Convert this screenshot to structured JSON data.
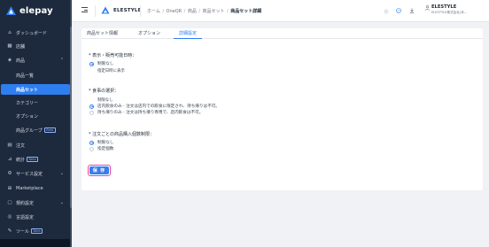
{
  "app": {
    "logo_text": "elepay"
  },
  "sidebar": {
    "items": [
      {
        "label": "ダッシュボード",
        "icon": "home-icon"
      },
      {
        "label": "店舗",
        "icon": "store-icon"
      },
      {
        "label": "商品",
        "icon": "tag-icon",
        "expanded": true
      },
      {
        "label": "商品一覧",
        "sub": true
      },
      {
        "label": "商品セット",
        "sub": true,
        "active": true
      },
      {
        "label": "カテゴリー",
        "sub": true
      },
      {
        "label": "オプション",
        "sub": true
      },
      {
        "label": "商品グループ",
        "sub": true,
        "badge": "Beta"
      },
      {
        "label": "注文",
        "icon": "receipt-icon"
      },
      {
        "label": "統計",
        "icon": "chart-icon",
        "badge": "Beta"
      },
      {
        "label": "サービス設定",
        "icon": "settings-icon",
        "chevron": true
      },
      {
        "label": "Marketplace",
        "icon": "grid-icon"
      },
      {
        "label": "規約設定",
        "icon": "document-icon",
        "chevron": true
      },
      {
        "label": "言語設定",
        "icon": "globe-icon"
      },
      {
        "label": "ツール",
        "icon": "wrench-icon",
        "badge": "Beta"
      }
    ]
  },
  "header": {
    "brand": "ELESTYLE",
    "breadcrumb": [
      "ホーム",
      "OneQR",
      "商品",
      "商品セット",
      "商品セット詳細"
    ],
    "user_name": "ELESTYLE",
    "user_sub": "ELESTYLE株式会社(本..."
  },
  "tabs": [
    "商品セット情報",
    "オプション",
    "詳細設定"
  ],
  "active_tab": 2,
  "sections": {
    "display": {
      "title": "表示・販売可能日時：",
      "options": [
        "制限なし",
        "指定日時に表示"
      ],
      "selected": 0
    },
    "meal": {
      "title": "食事の選択：",
      "options": [
        "制限なし",
        "店内飲食のみ - 注文は店内での飲食に限定され、持ち帰りは不可。",
        "持ち帰りのみ - 注文は持ち帰り専用で、店内飲食は不可。"
      ],
      "selected": 1
    },
    "limit": {
      "title": "注文ごとの商品購入個数制限：",
      "options": [
        "制限なし",
        "指定個数"
      ],
      "selected": 0
    }
  },
  "save_label": "保 存",
  "colors": {
    "accent": "#2e7ef0",
    "sidebar": "#1d2a3e",
    "focus_ring": "#e74694"
  }
}
